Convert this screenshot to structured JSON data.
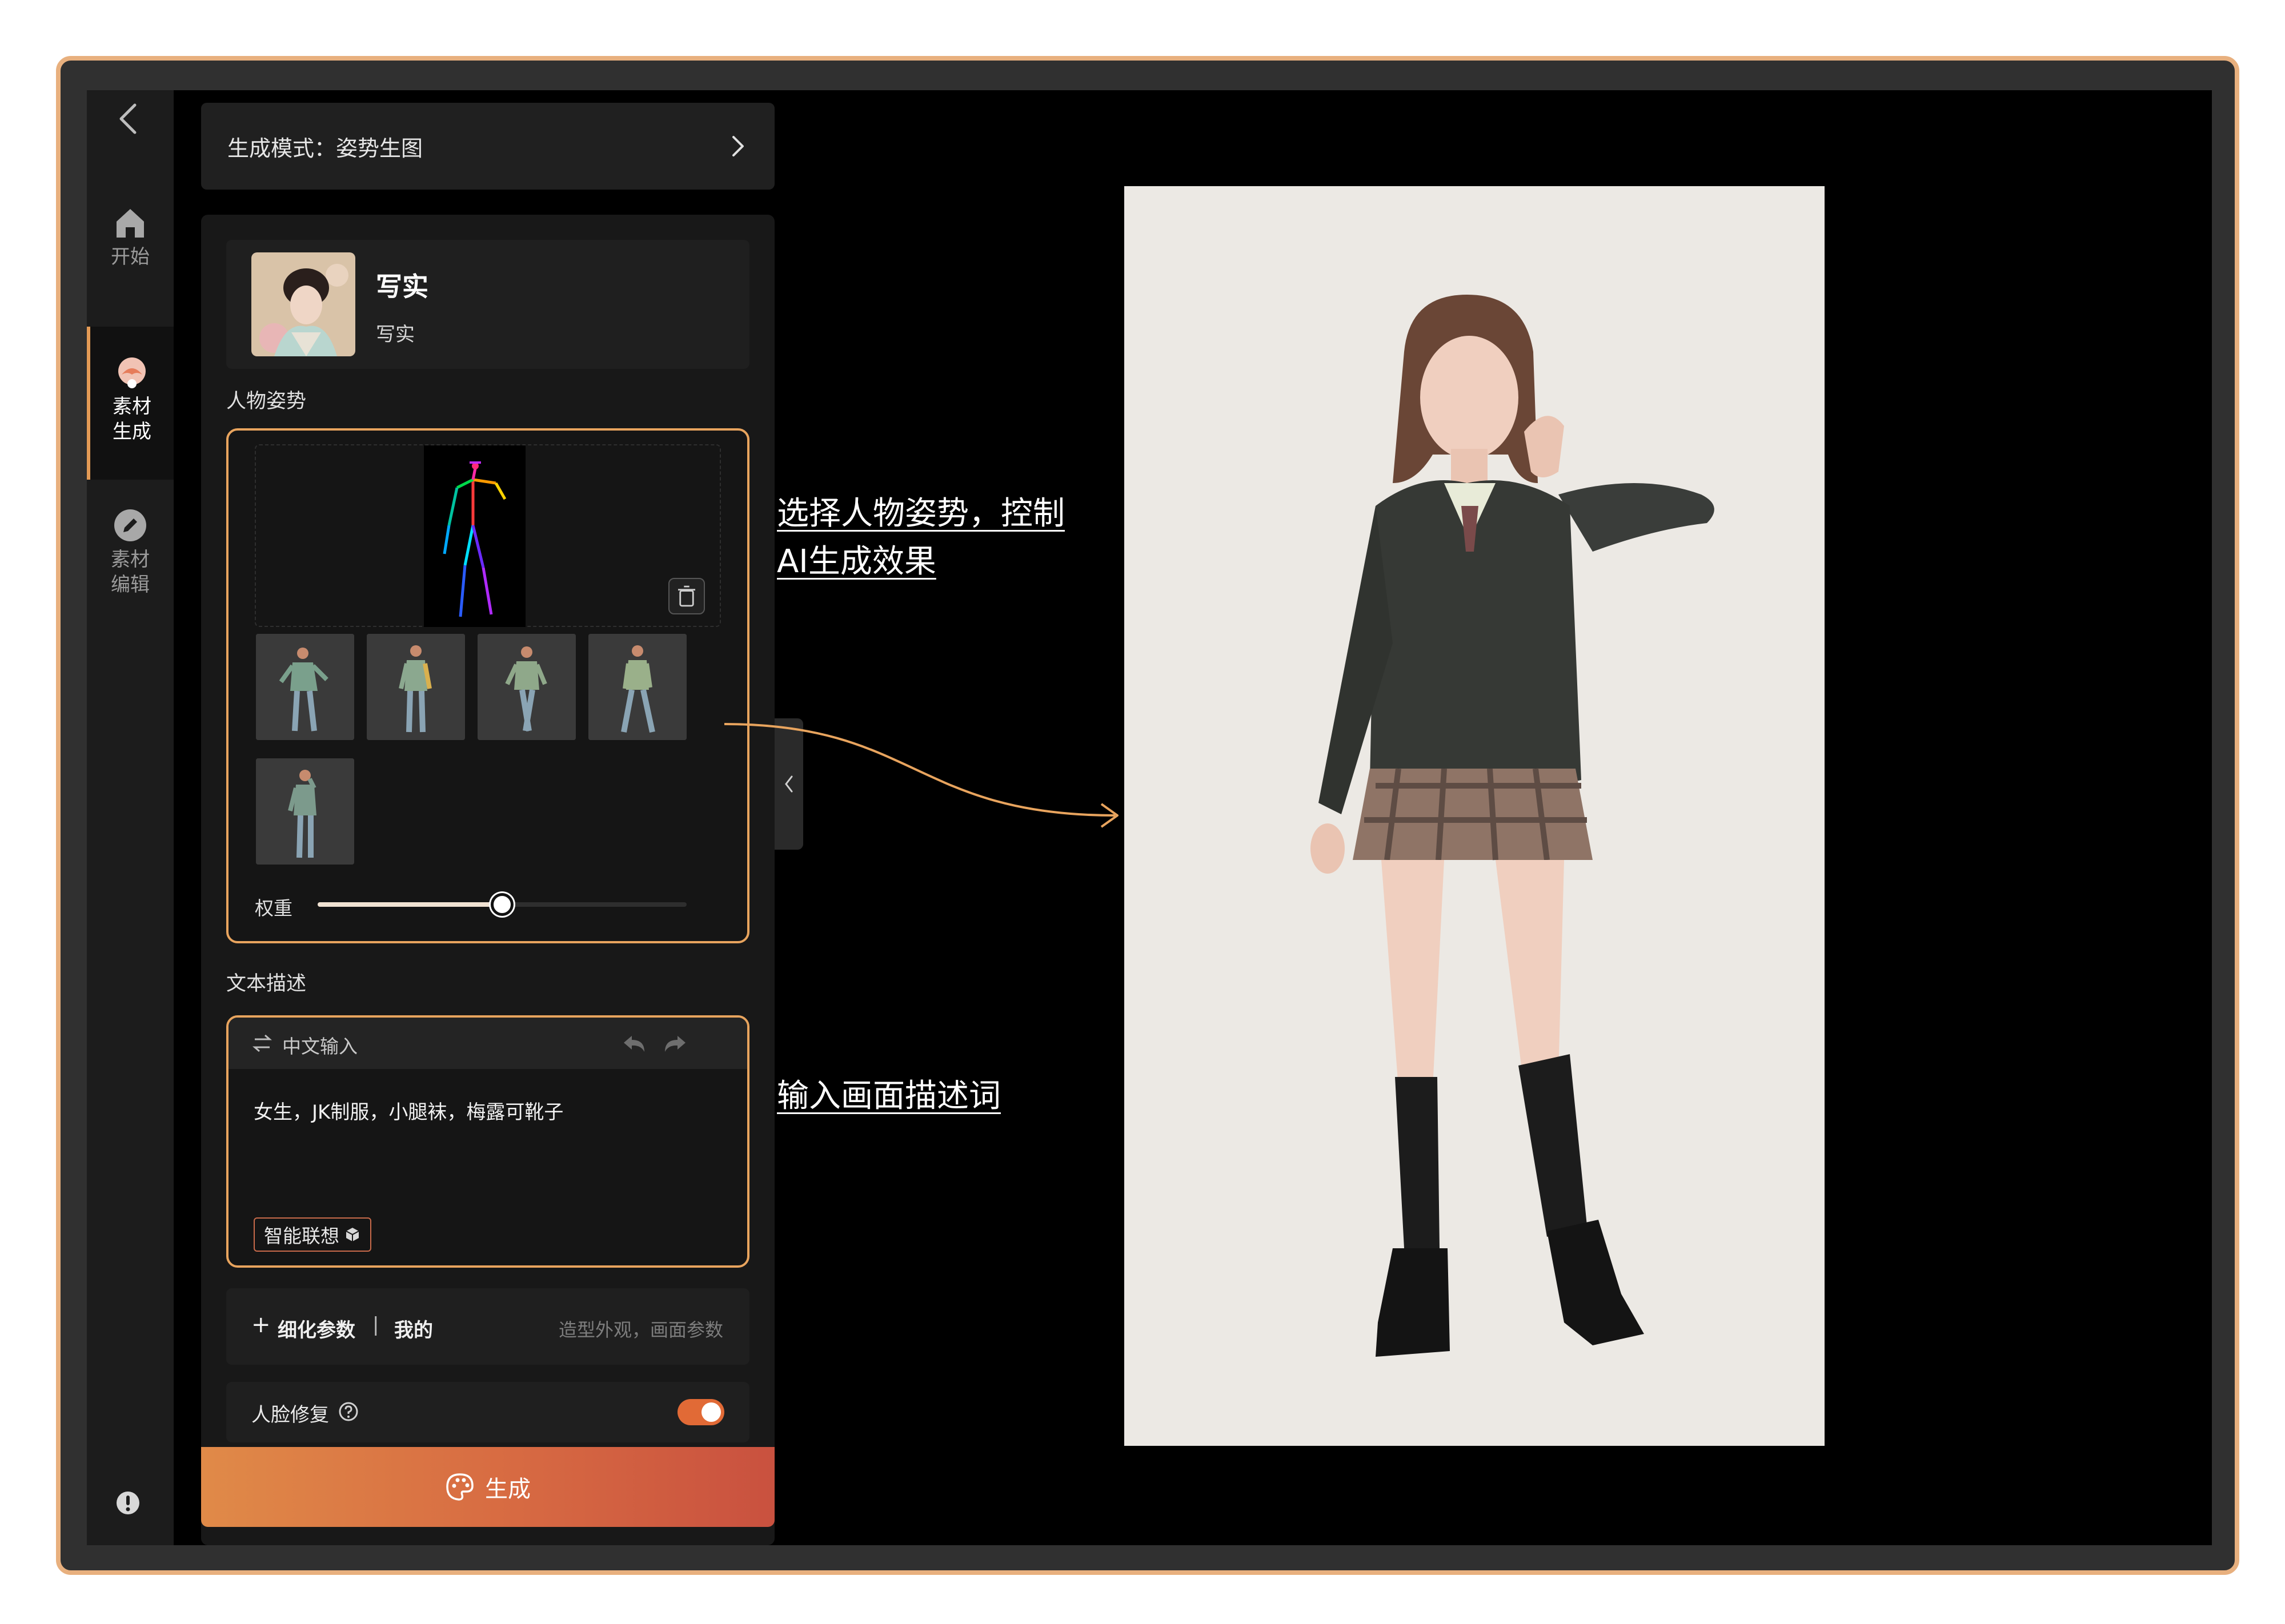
{
  "sidebar": {
    "items": [
      {
        "label": "开始",
        "icon": "home-icon"
      },
      {
        "label": "素材\n生成",
        "icon": "material-generate-icon"
      },
      {
        "label": "素材\n编辑",
        "icon": "edit-icon"
      }
    ],
    "active_index": 1
  },
  "panel": {
    "mode_label": "生成模式：姿势生图",
    "style": {
      "title": "写实",
      "subtitle": "写实"
    },
    "pose_section_label": "人物姿势",
    "weight_label": "权重",
    "weight_value": 0.5,
    "text_section_label": "文本描述",
    "text_input": {
      "language_label": "中文输入",
      "content": "女生，JK制服，小腿袜，梅露可靴子",
      "smart_button_label": "智能联想"
    },
    "refine": {
      "plus": "+",
      "label": "细化参数",
      "separator": "|",
      "mine_label": "我的",
      "hint": "造型外观，画面参数"
    },
    "face_repair": {
      "label": "人脸修复",
      "enabled": true
    },
    "generate_label": "生成"
  },
  "annotations": {
    "pose_note_line1": "选择人物姿势，控制",
    "pose_note_line2": "AI生成效果",
    "text_note": "输入画面描述词"
  },
  "colors": {
    "accent": "#e8a45e",
    "toggle_on": "#e16a36",
    "generate_gradient_start": "#e08a48",
    "generate_gradient_end": "#c9513f"
  }
}
